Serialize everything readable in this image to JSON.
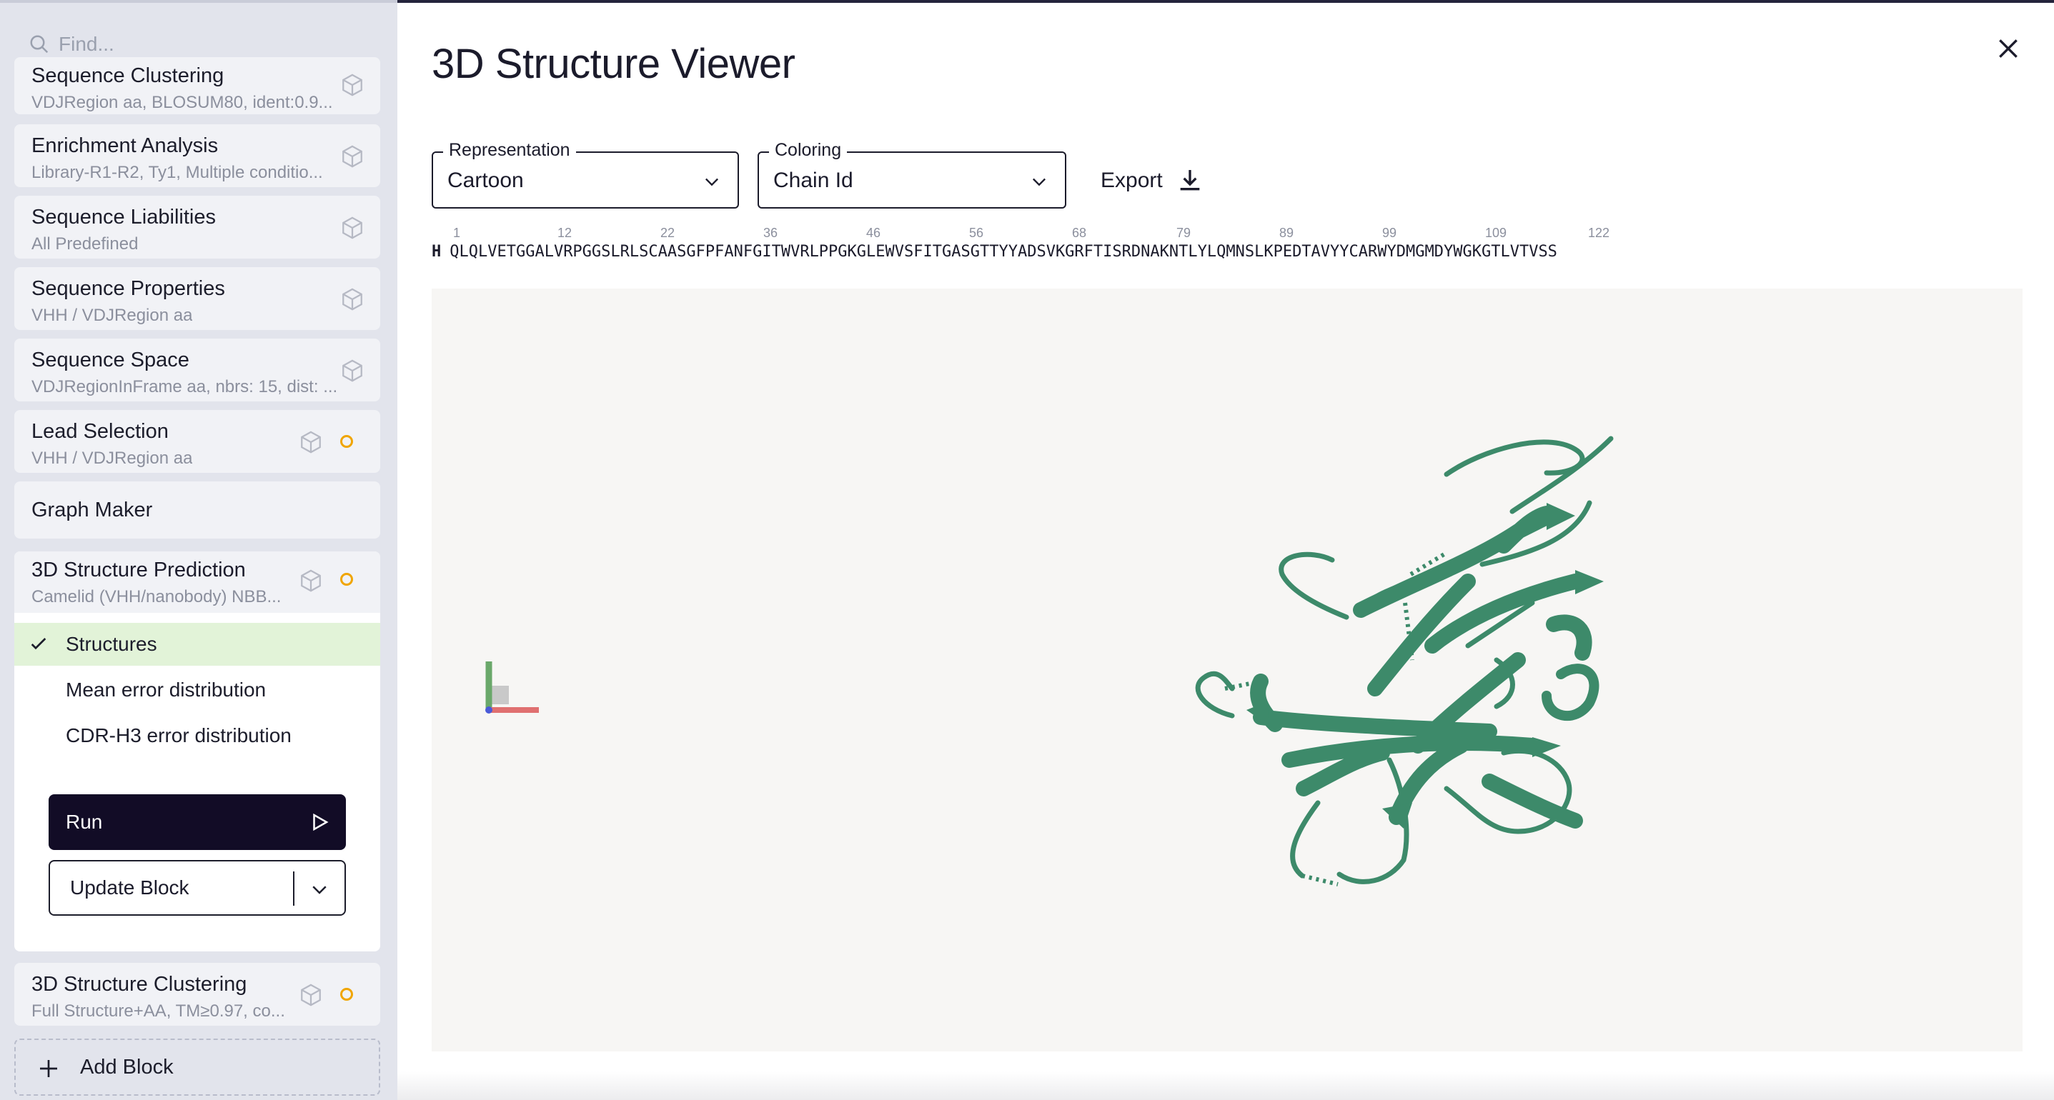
{
  "sidebar": {
    "search_placeholder": "Find...",
    "blocks": [
      {
        "title": "Sequence Clustering",
        "subtitle": "VDJRegion aa, BLOSUM80, ident:0.9...",
        "status": "none"
      },
      {
        "title": "Enrichment Analysis",
        "subtitle": "Library-R1-R2, Ty1, Multiple conditio...",
        "status": "none"
      },
      {
        "title": "Sequence Liabilities",
        "subtitle": "All Predefined",
        "status": "none"
      },
      {
        "title": "Sequence Properties",
        "subtitle": "VHH / VDJRegion aa",
        "status": "none"
      },
      {
        "title": "Sequence Space",
        "subtitle": "VDJRegionInFrame aa, nbrs: 15, dist: ...",
        "status": "none"
      },
      {
        "title": "Lead Selection",
        "subtitle": "VHH / VDJRegion aa",
        "status": "pending"
      },
      {
        "title": "Graph Maker",
        "subtitle": "",
        "status": "none"
      }
    ],
    "expanded_block": {
      "title": "3D Structure Prediction",
      "subtitle": "Camelid (VHH/nanobody) NBB...",
      "status": "pending",
      "items": [
        {
          "label": "Structures",
          "active": true
        },
        {
          "label": "Mean error distribution",
          "active": false
        },
        {
          "label": "CDR-H3 error distribution",
          "active": false
        }
      ],
      "run_label": "Run",
      "update_label": "Update Block"
    },
    "after_blocks": [
      {
        "title": "3D Structure Clustering",
        "subtitle": "Full Structure+AA, TM≥0.97, co...",
        "status": "pending"
      }
    ],
    "add_block_label": "Add Block"
  },
  "panel": {
    "title": "3D Structure Viewer",
    "representation": {
      "label": "Representation",
      "value": "Cartoon"
    },
    "coloring": {
      "label": "Coloring",
      "value": "Chain Id"
    },
    "export_label": "Export",
    "sequence": {
      "chain": "H",
      "residues": "QLQLVETGGALVRPGGSLRLSCAASGFPFANFGITWVRLPPGKGLEWVSFITGASGTTYYADSVKGRFTISRDNAKNTLYLQMNSLKPEDTAVYYCARWYDMGMDYWGKGTLVTVSS",
      "markers": [
        "1",
        "12",
        "22",
        "36",
        "46",
        "56",
        "68",
        "79",
        "89",
        "99",
        "109",
        "122"
      ]
    },
    "structure_color": "#3d8a6a"
  },
  "colors": {
    "accent_dark": "#120c26",
    "pending": "#f0a500",
    "active_bg": "#e2f3d8"
  }
}
